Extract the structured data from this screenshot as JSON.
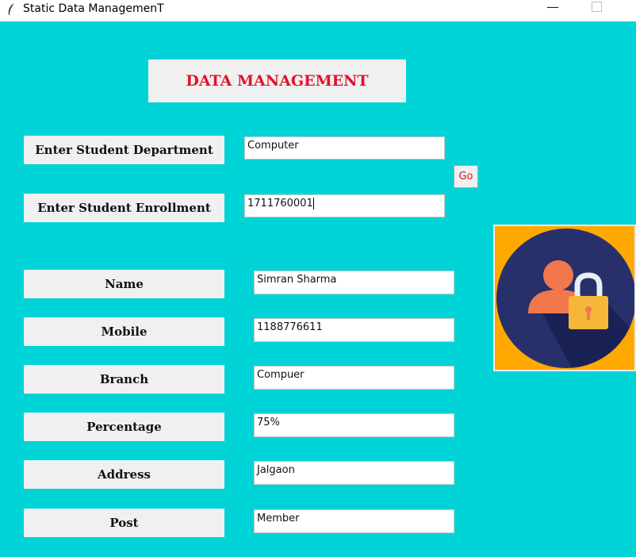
{
  "window": {
    "title": "Static Data ManagemenT",
    "minimize_glyph": "—"
  },
  "heading": "DATA MANAGEMENT",
  "search": {
    "department_label": "Enter Student Department",
    "department_value": "Computer",
    "enrollment_label": "Enter Student Enrollment",
    "enrollment_value": "1711760001",
    "go_label": "Go"
  },
  "fields": [
    {
      "label": "Name",
      "value": "Simran Sharma"
    },
    {
      "label": "Mobile",
      "value": "1188776611"
    },
    {
      "label": "Branch",
      "value": "Compuer"
    },
    {
      "label": "Percentage",
      "value": "75%"
    },
    {
      "label": "Address",
      "value": "Jalgaon"
    },
    {
      "label": "Post",
      "value": "Member"
    }
  ],
  "image": {
    "icon": "user-lock-icon",
    "colors": {
      "background": "#ffa900",
      "circle": "#27306b",
      "person": "#f2774c",
      "lock_body": "#f5b63a"
    }
  },
  "colors": {
    "window_bg": "#00d4d6",
    "heading_text": "#e0142b",
    "label_bg": "#f0f0f0"
  }
}
